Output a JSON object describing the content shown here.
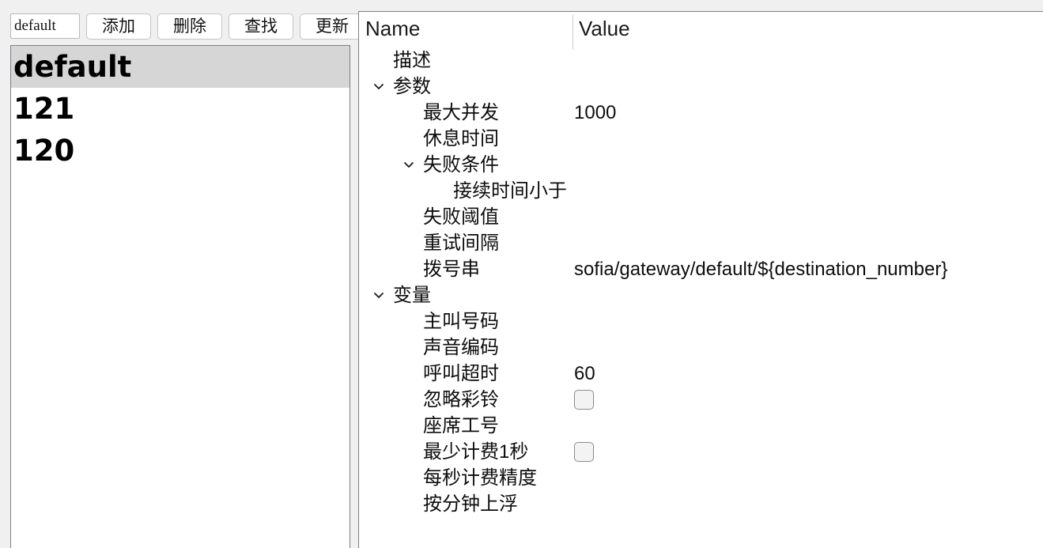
{
  "toolbar": {
    "name_input_value": "default",
    "name_input_placeholder": "",
    "buttons": [
      {
        "label": "添加",
        "name": "add-button"
      },
      {
        "label": "删除",
        "name": "delete-button"
      },
      {
        "label": "查找",
        "name": "search-button"
      },
      {
        "label": "更新",
        "name": "update-button"
      }
    ]
  },
  "list": {
    "items": [
      {
        "label": "default",
        "selected": true
      },
      {
        "label": "121",
        "selected": false
      },
      {
        "label": "120",
        "selected": false
      }
    ]
  },
  "tree": {
    "header": {
      "name_column": "Name",
      "value_column": "Value"
    },
    "rows": [
      {
        "label": "描述",
        "value": "",
        "level": 1,
        "chevron": "none",
        "control": "none"
      },
      {
        "label": "参数",
        "value": "",
        "level": 1,
        "chevron": "expanded",
        "control": "none"
      },
      {
        "label": "最大并发",
        "value": "1000",
        "level": 2,
        "chevron": "none",
        "control": "text"
      },
      {
        "label": "休息时间",
        "value": "",
        "level": 2,
        "chevron": "none",
        "control": "none"
      },
      {
        "label": "失败条件",
        "value": "",
        "level": 2,
        "chevron": "expanded",
        "control": "none"
      },
      {
        "label": "接续时间小于",
        "value": "",
        "level": 3,
        "chevron": "none",
        "control": "none"
      },
      {
        "label": "失败阈值",
        "value": "",
        "level": 2,
        "chevron": "none",
        "control": "none"
      },
      {
        "label": "重试间隔",
        "value": "",
        "level": 2,
        "chevron": "none",
        "control": "none"
      },
      {
        "label": "拨号串",
        "value": "sofia/gateway/default/${destination_number}",
        "level": 2,
        "chevron": "none",
        "control": "text"
      },
      {
        "label": "变量",
        "value": "",
        "level": 1,
        "chevron": "expanded",
        "control": "none"
      },
      {
        "label": "主叫号码",
        "value": "",
        "level": 2,
        "chevron": "none",
        "control": "none"
      },
      {
        "label": "声音编码",
        "value": "",
        "level": 2,
        "chevron": "none",
        "control": "none"
      },
      {
        "label": "呼叫超时",
        "value": "60",
        "level": 2,
        "chevron": "none",
        "control": "text"
      },
      {
        "label": "忽略彩铃",
        "value": "",
        "level": 2,
        "chevron": "none",
        "control": "checkbox",
        "checked": false
      },
      {
        "label": "座席工号",
        "value": "",
        "level": 2,
        "chevron": "none",
        "control": "none"
      },
      {
        "label": "最少计费1秒",
        "value": "",
        "level": 2,
        "chevron": "none",
        "control": "checkbox",
        "checked": false
      },
      {
        "label": "每秒计费精度",
        "value": "",
        "level": 2,
        "chevron": "none",
        "control": "none"
      },
      {
        "label": "按分钟上浮",
        "value": "",
        "level": 2,
        "chevron": "none",
        "control": "none"
      }
    ]
  },
  "colors": {
    "selection_bg": "#d6d6d6",
    "panel_border": "#7b8086",
    "window_bg": "#f0f0f0"
  }
}
